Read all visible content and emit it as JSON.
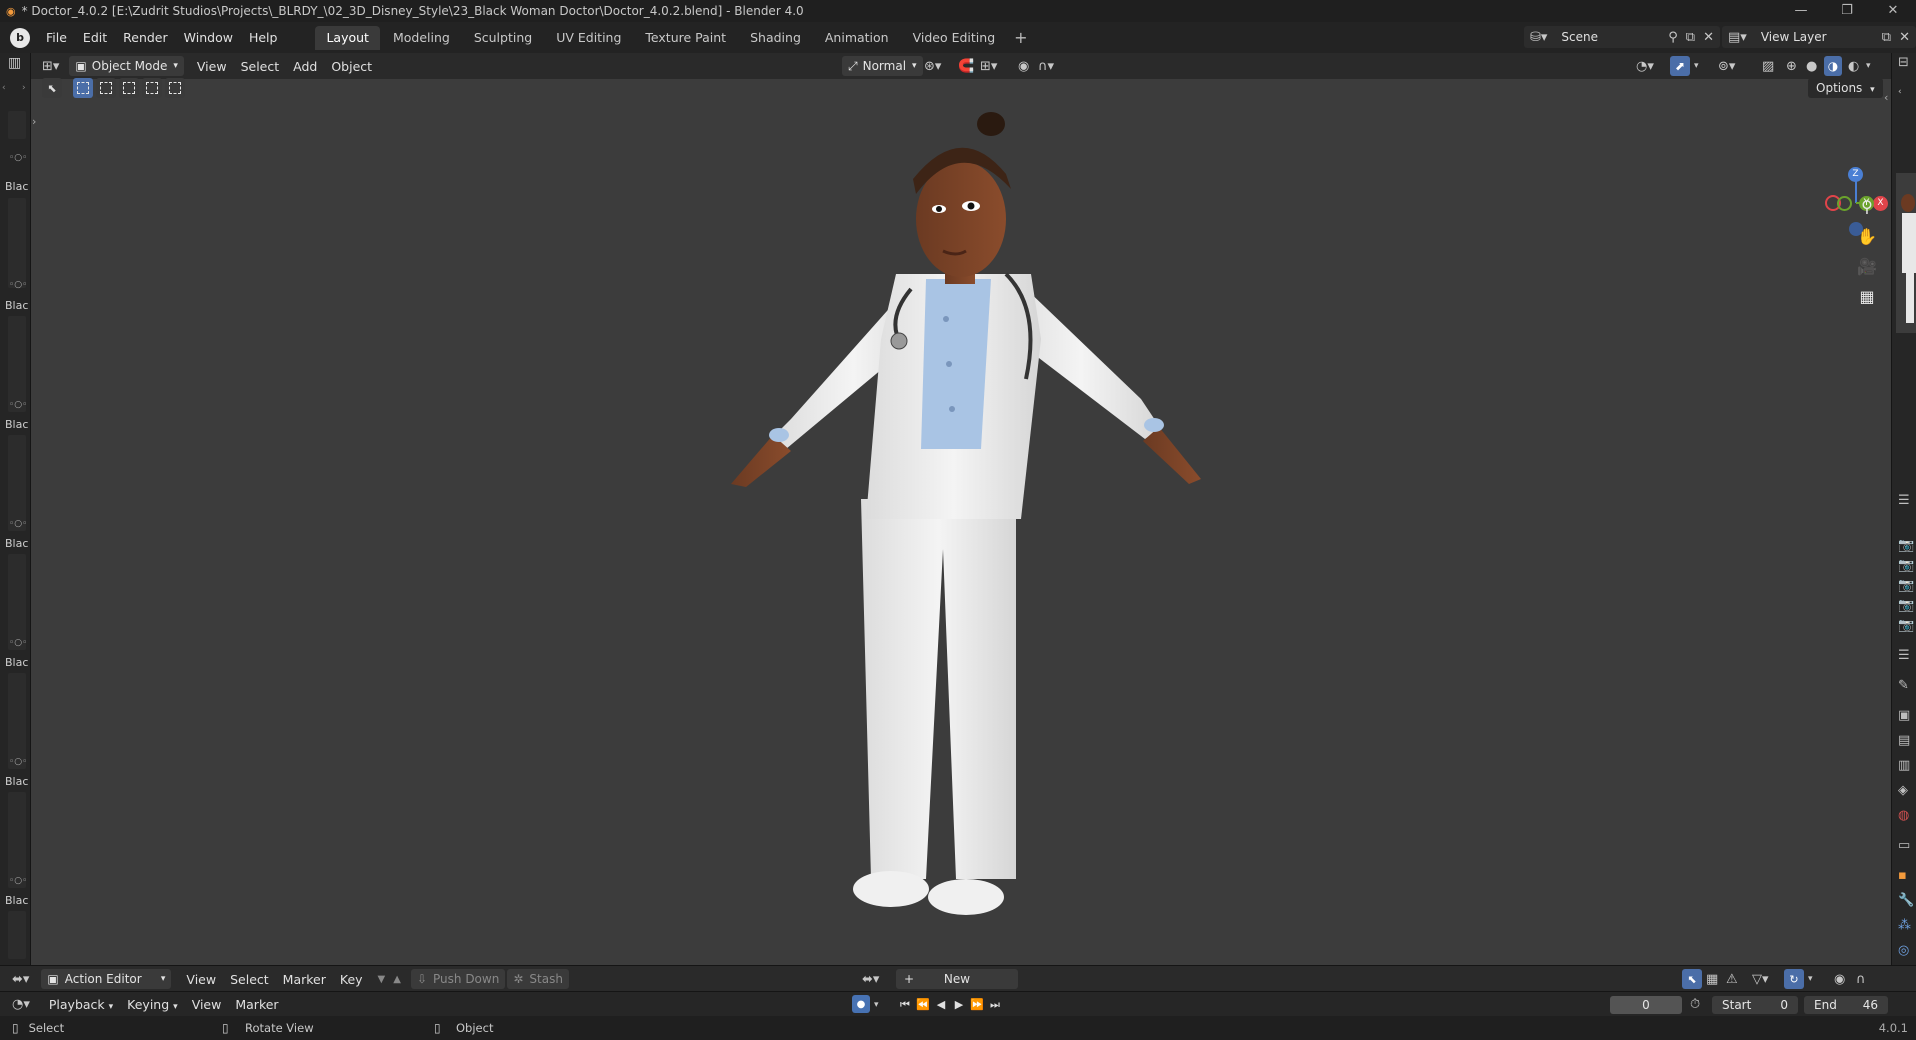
{
  "titlebar": {
    "title": "* Doctor_4.0.2 [E:\\Zudrit Studios\\Projects\\_BLRDY_\\02_3D_Disney_Style\\23_Black Woman Doctor\\Doctor_4.0.2.blend] - Blender 4.0",
    "minimize": "—",
    "restore": "❐",
    "close": "✕"
  },
  "menu": [
    "File",
    "Edit",
    "Render",
    "Window",
    "Help"
  ],
  "workspaces": [
    "Layout",
    "Modeling",
    "Sculpting",
    "UV Editing",
    "Texture Paint",
    "Shading",
    "Animation",
    "Video Editing"
  ],
  "active_workspace": "Layout",
  "scene": "Scene",
  "view_layer": "View Layer",
  "viewport_header": {
    "mode": "Object Mode",
    "menus": [
      "View",
      "Select",
      "Add",
      "Object"
    ],
    "orientation": "Normal"
  },
  "options_label": "Options",
  "left_strip_labels": [
    "Blac",
    "Blac",
    "Blac",
    "Blac",
    "Blac",
    "Blac",
    "Blac"
  ],
  "gizmo": {
    "z": "Z",
    "x": "X",
    "y": "Y"
  },
  "action_editor": {
    "mode": "Action Editor",
    "menus": [
      "View",
      "Select",
      "Marker",
      "Key"
    ],
    "push_down": "Push Down",
    "stash": "Stash",
    "new": "New"
  },
  "playback": {
    "menus": [
      "Playback",
      "Keying",
      "View",
      "Marker"
    ],
    "current_frame": "0",
    "start_label": "Start",
    "start": "0",
    "end_label": "End",
    "end": "46"
  },
  "status": {
    "select": "Select",
    "rotate": "Rotate View",
    "object": "Object",
    "version": "4.0.1"
  },
  "colors": {
    "accent": "#4772b3",
    "viewport_bg": "#3d3d3d",
    "title_icon": "#f39a3c"
  }
}
